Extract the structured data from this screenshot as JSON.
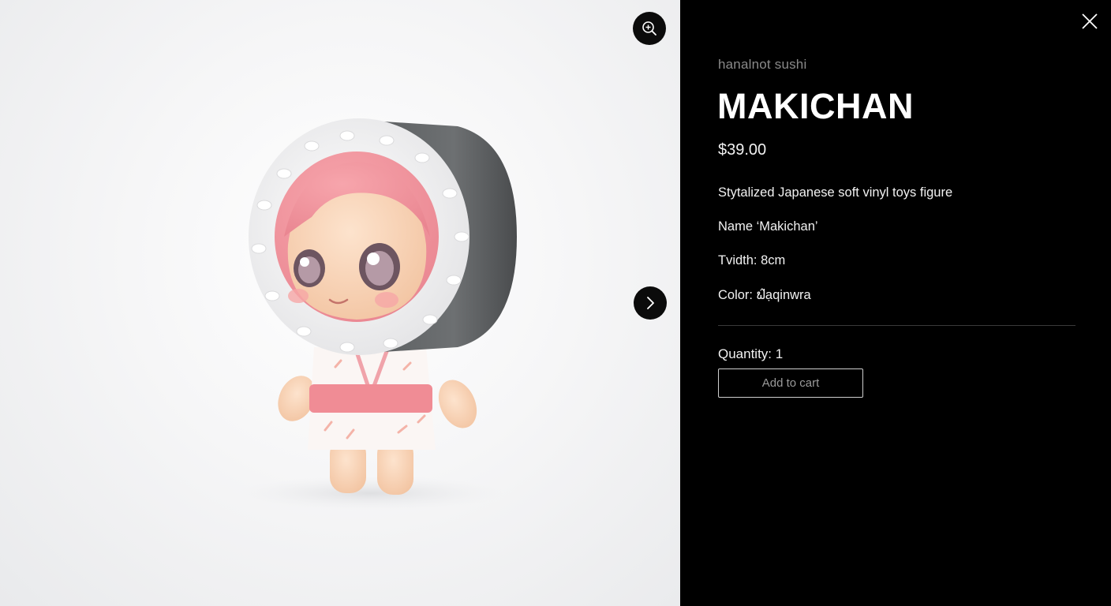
{
  "product": {
    "brand": "hanalnot sushi",
    "title": "MAKICHAN",
    "price": "$39.00",
    "description": [
      "Stytalized Japanese soft vinyl toys figure",
      "Name ‘Makichan’",
      "Tvidth: 8cm",
      "Color: ຟ̂ạqinwra"
    ],
    "quantity_label": "Quantity: 1",
    "add_to_cart_label": "Add to cart"
  },
  "icons": {
    "zoom": "zoom-in-icon",
    "next": "chevron-right-icon",
    "close": "close-icon"
  },
  "colors": {
    "panel_bg": "#000000",
    "button_bg": "#0b0b0b",
    "brand_text": "#8a8a8a"
  }
}
